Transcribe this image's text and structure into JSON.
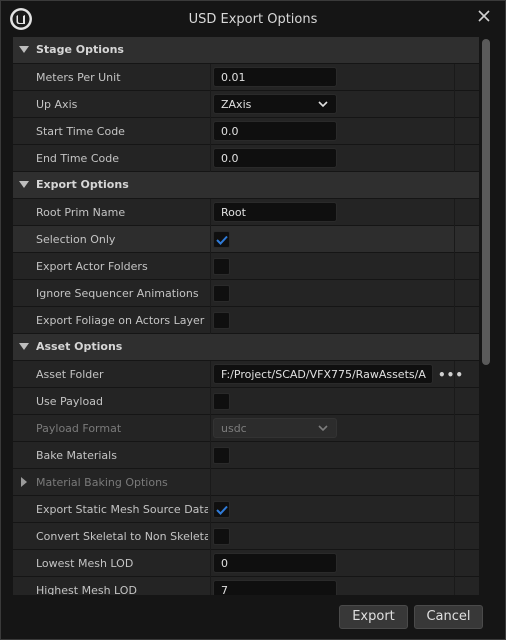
{
  "window": {
    "title": "USD Export Options"
  },
  "sections": {
    "stage": {
      "label": "Stage Options"
    },
    "export": {
      "label": "Export Options"
    },
    "asset": {
      "label": "Asset Options"
    }
  },
  "props": {
    "meters_per_unit": {
      "label": "Meters Per Unit",
      "value": "0.01"
    },
    "up_axis": {
      "label": "Up Axis",
      "value": "ZAxis"
    },
    "start_time_code": {
      "label": "Start Time Code",
      "value": "0.0"
    },
    "end_time_code": {
      "label": "End Time Code",
      "value": "0.0"
    },
    "root_prim_name": {
      "label": "Root Prim Name",
      "value": "Root"
    },
    "selection_only": {
      "label": "Selection Only",
      "checked": true
    },
    "export_actor_folders": {
      "label": "Export Actor Folders",
      "checked": false
    },
    "ignore_sequencer": {
      "label": "Ignore Sequencer Animations",
      "checked": false
    },
    "export_foliage": {
      "label": "Export Foliage on Actors Layer",
      "checked": false
    },
    "asset_folder": {
      "label": "Asset Folder",
      "value": "F:/Project/SCAD/VFX775/RawAssets/A",
      "browse": "•••"
    },
    "use_payload": {
      "label": "Use Payload",
      "checked": false
    },
    "payload_format": {
      "label": "Payload Format",
      "value": "usdc",
      "enabled": false
    },
    "bake_materials": {
      "label": "Bake Materials",
      "checked": false
    },
    "material_baking": {
      "label": "Material Baking Options"
    },
    "export_static_mesh_source": {
      "label": "Export Static Mesh Source Data",
      "checked": true
    },
    "convert_skeletal": {
      "label": "Convert Skeletal to Non Skeletal",
      "checked": false
    },
    "lowest_mesh_lod": {
      "label": "Lowest Mesh LOD",
      "value": "0"
    },
    "highest_mesh_lod": {
      "label": "Highest Mesh LOD",
      "value": "7"
    }
  },
  "buttons": {
    "export": "Export",
    "cancel": "Cancel"
  },
  "colors": {
    "checkmark": "#2f7bd9",
    "section_bg": "#2f2f2f",
    "row_bg": "#242424"
  }
}
